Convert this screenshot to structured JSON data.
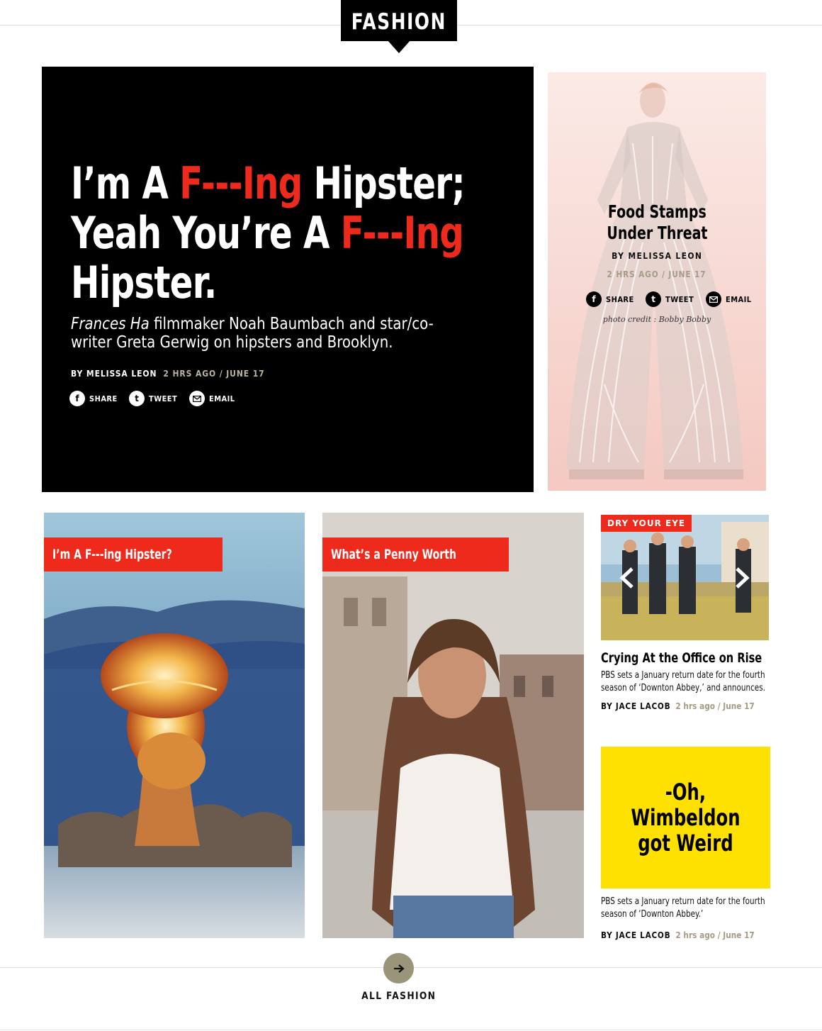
{
  "section": {
    "title": "FASHION"
  },
  "hero": {
    "title_parts": [
      "I’m A ",
      "F---Ing",
      " Hipster;",
      "Yeah You’re A ",
      "F---Ing",
      "Hipster."
    ],
    "dek_italic": "Frances Ha",
    "dek_rest": " filmmaker Noah Baumbach and star/co-writer Greta Gerwig on hipsters and Brooklyn.",
    "byline": "BY MELISSA LEON",
    "time": "2 HRS AGO / JUNE 17",
    "share_label": "SHARE",
    "tweet_label": "TWEET",
    "email_label": "EMAIL"
  },
  "side": {
    "title_line1": "Food Stamps",
    "title_line2": "Under Threat",
    "byline": "BY MELISSA LEON",
    "time": "2 HRS AGO / JUNE 17",
    "share_label": "SHARE",
    "tweet_label": "TWEET",
    "email_label": "EMAIL",
    "credit": "photo credit : Bobby Bobby"
  },
  "card1": {
    "tag": "I’m A F---ing Hipster?"
  },
  "card2": {
    "tag": "What’s a Penny Worth"
  },
  "right_col": {
    "tag": "DRY YOUR EYE",
    "title": "Crying At the Office on Rise",
    "dek": "PBS sets a January return date for the fourth season of ‘Downton Abbey,’ and announces.",
    "byline": "BY JACE LACOB",
    "time": "2 hrs ago / June 17"
  },
  "yellow_card": {
    "line1": "-Oh,",
    "line2": "Wimbeldon",
    "line3": "got Weird",
    "dek": "PBS sets a January return date for the fourth season of ‘Downton Abbey.’",
    "byline": "BY JACE LACOB",
    "time": "2 hrs ago / June 17"
  },
  "footer": {
    "all_label": "ALL FASHION"
  },
  "colors": {
    "accent": "#ee2a1c",
    "yellow": "#ffe100",
    "muted": "#a59c86",
    "button": "#9a957a"
  }
}
